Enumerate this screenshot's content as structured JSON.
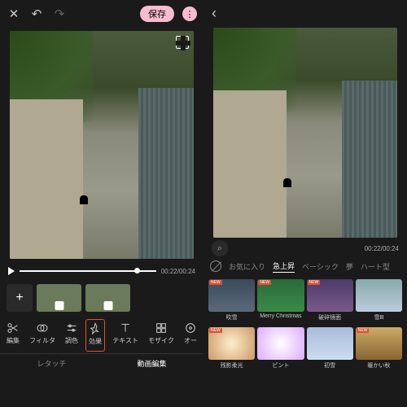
{
  "header": {
    "save_label": "保存"
  },
  "timeline": {
    "time_current": "00:22",
    "time_total": "00:24",
    "add_label": "+"
  },
  "tools": [
    {
      "label": "編集",
      "icon": "scissors"
    },
    {
      "label": "フィルタ",
      "icon": "circles"
    },
    {
      "label": "調色",
      "icon": "sliders"
    },
    {
      "label": "効果",
      "icon": "pin",
      "selected": true
    },
    {
      "label": "テキスト",
      "icon": "text"
    },
    {
      "label": "モザイク",
      "icon": "mosaic"
    },
    {
      "label": "オー",
      "icon": "audio"
    }
  ],
  "modes": [
    {
      "label": "レタッチ"
    },
    {
      "label": "動画編集",
      "active": true
    }
  ],
  "effects_panel": {
    "time_current": "00:22",
    "time_total": "00:24",
    "tabs": [
      {
        "label": "お気に入り"
      },
      {
        "label": "急上昇",
        "active": true
      },
      {
        "label": "ベーシック"
      },
      {
        "label": "夢"
      },
      {
        "label": "ハート型"
      }
    ],
    "effects": [
      {
        "label": "吹雪",
        "badge": "NEW",
        "bg": "linear-gradient(#3a4a5a,#5a6a7a)"
      },
      {
        "label": "Merry Christmas",
        "badge": "NEW",
        "bg": "linear-gradient(#2a6a3a,#3a8a4a)"
      },
      {
        "label": "破碎镜面",
        "badge": "NEW",
        "bg": "linear-gradient(#4a3a6a,#7a5a8a)"
      },
      {
        "label": "雪Ⅲ",
        "bg": "linear-gradient(#8aa,#bcd)"
      },
      {
        "label": "残影柔光",
        "badge": "NEW",
        "bg": "radial-gradient(circle,#fec,#c96)"
      },
      {
        "label": "ピント",
        "bg": "radial-gradient(circle,#fff,#daf)"
      },
      {
        "label": "初雪",
        "bg": "linear-gradient(#abd,#cde)"
      },
      {
        "label": "暖かい秋",
        "badge": "NEW",
        "bg": "linear-gradient(#ca6,#863)"
      }
    ]
  }
}
